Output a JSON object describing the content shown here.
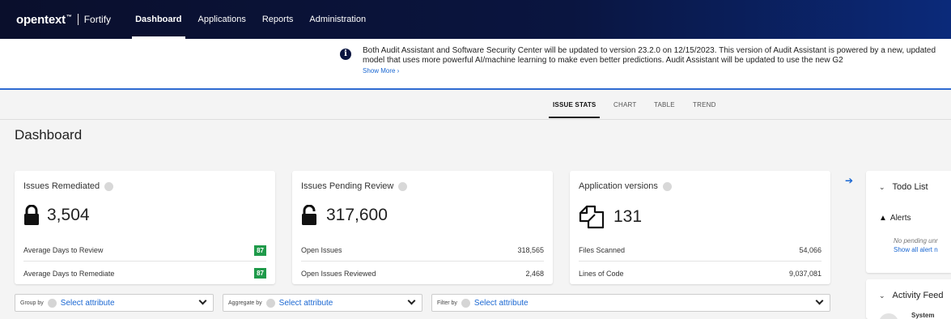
{
  "nav": {
    "logo": "opentext",
    "logo_mark": "™",
    "product": "Fortify",
    "items": [
      "Dashboard",
      "Applications",
      "Reports",
      "Administration"
    ],
    "active": "Dashboard"
  },
  "banner": {
    "icon": "info-icon",
    "text": "Both Audit Assistant and Software Security Center will be updated to version 23.2.0 on 12/15/2023. This version of Audit Assistant is powered by a new, updated model that uses more powerful AI/machine learning to make even better predictions. Audit Assistant will be updated to use the new G2",
    "show_more": "Show More ›"
  },
  "subtabs": [
    "ISSUE STATS",
    "CHART",
    "TABLE",
    "TREND"
  ],
  "page_title": "Dashboard",
  "cards": [
    {
      "title": "Issues Remediated",
      "icon": "lock-closed-icon",
      "value": "3,504",
      "rows": [
        {
          "label": "Average Days to Review",
          "value": "87"
        },
        {
          "label": "Average Days to Remediate",
          "value": "87"
        }
      ]
    },
    {
      "title": "Issues Pending Review",
      "icon": "lock-open-icon",
      "value": "317,600",
      "rows": [
        {
          "label": "Open Issues",
          "value": "318,565"
        },
        {
          "label": "Open Issues Reviewed",
          "value": "2,468"
        }
      ]
    },
    {
      "title": "Application versions",
      "icon": "documents-icon",
      "value": "131",
      "rows": [
        {
          "label": "Files Scanned",
          "value": "54,066"
        },
        {
          "label": "Lines of Code",
          "value": "9,037,081"
        }
      ]
    }
  ],
  "right_panel": {
    "todo_title": "Todo List",
    "alerts_label": "Alerts",
    "no_pending": "No pending unr",
    "show_all": "Show all alert n",
    "activity_title": "Activity Feed",
    "activity_item": "System"
  },
  "filters": {
    "group_by_label": "Group by",
    "aggregate_by_label": "Aggregate by",
    "filter_by_label": "Filter by",
    "placeholder": "Select attribute"
  },
  "colors": {
    "nav_bg": "#0a1540",
    "accent_blue": "#1a67d2",
    "badge_green": "#1f9a4a"
  }
}
